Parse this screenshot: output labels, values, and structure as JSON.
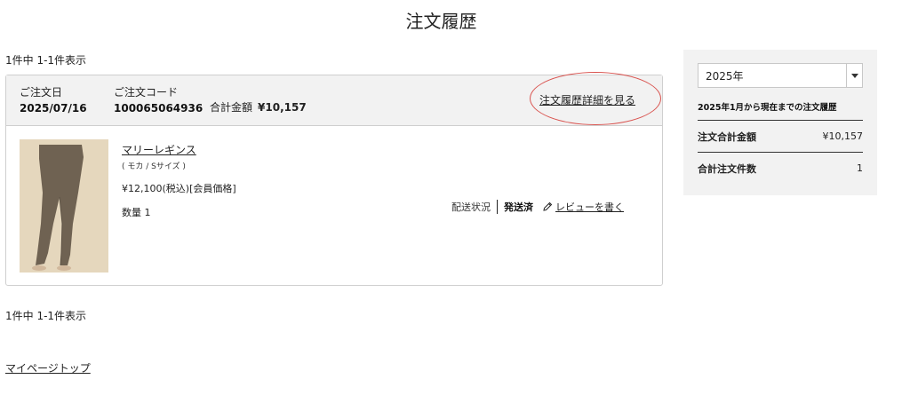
{
  "page": {
    "title": "注文履歴"
  },
  "pagination": {
    "top_text": "1件中 1-1件表示",
    "bottom_text": "1件中 1-1件表示"
  },
  "order": {
    "date_label": "ご注文日",
    "date": "2025/07/16",
    "code_label": "ご注文コード",
    "code": "100065064936",
    "total_label": "合計金額",
    "total": "¥10,157",
    "detail_link": "注文履歴詳細を見る",
    "product": {
      "name": "マリーレギンス",
      "variant": "( モカ / Sサイズ )",
      "price": "¥12,100(税込)[会員価格]",
      "quantity": "数量 1"
    },
    "shipping": {
      "status_label": "配送状況",
      "status": "発送済",
      "review_link": "レビューを書く",
      "review_icon": "pencil-icon"
    }
  },
  "footer": {
    "mypage_link": "マイページトップ"
  },
  "sidebar": {
    "year_select": "2025年",
    "period_text": "2025年1月から現在までの注文履歴",
    "total_label": "注文合計金額",
    "total_value": "¥10,157",
    "count_label": "合計注文件数",
    "count_value": "1"
  },
  "colors": {
    "highlight_oval": "#d9534f",
    "panel_bg": "#f2f2f2"
  }
}
